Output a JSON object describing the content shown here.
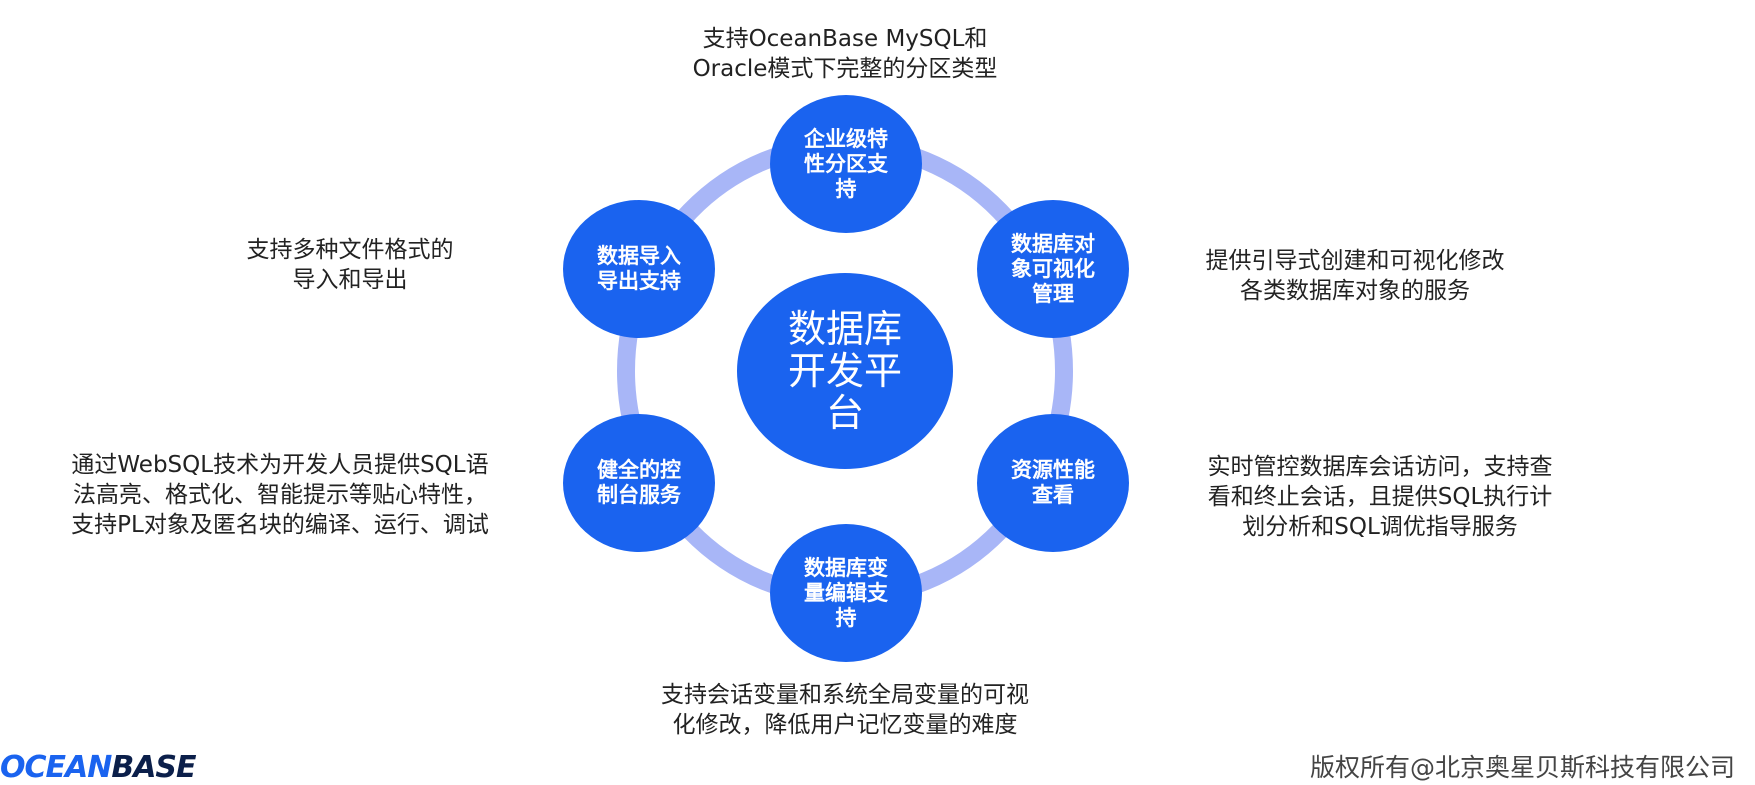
{
  "colors": {
    "node": "#1a63ef",
    "ring": "#a8b6f7",
    "text": "#222222"
  },
  "center": {
    "label": "数据库\n开发平\n台"
  },
  "features": [
    {
      "label": "企业级特\n性分区支\n持",
      "description": "支持OceanBase MySQL和\nOracle模式下完整的分区类型"
    },
    {
      "label": "数据库对\n象可视化\n管理",
      "description": "提供引导式创建和可视化修改\n各类数据库对象的服务"
    },
    {
      "label": "资源性能\n查看",
      "description": "实时管控数据库会话访问，支持查\n看和终止会话，且提供SQL执行计\n划分析和SQL调优指导服务"
    },
    {
      "label": "数据库变\n量编辑支\n持",
      "description": "支持会话变量和系统全局变量的可视\n化修改，降低用户记忆变量的难度"
    },
    {
      "label": "健全的控\n制台服务",
      "description": "通过WebSQL技术为开发人员提供SQL语\n法高亮、格式化、智能提示等贴心特性，\n支持PL对象及匿名块的编译、运行、调试"
    },
    {
      "label": "数据导入\n导出支持",
      "description": "支持多种文件格式的\n导入和导出"
    }
  ],
  "footer": {
    "logo_part1": "OCEAN",
    "logo_part2": "BASE",
    "copyright": "版权所有@北京奥星贝斯科技有限公司"
  }
}
